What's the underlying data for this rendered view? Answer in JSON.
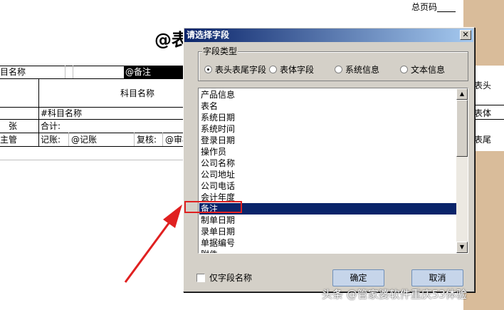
{
  "report": {
    "page_label": "总页码",
    "title": "@表",
    "cells": {
      "item_name": "目名称",
      "remark_field": "@备注",
      "subject_name": "科目名称",
      "subject_name_field": "#科目名称",
      "sheet_unit": "张",
      "total": "合计:",
      "supervisor": "主管",
      "bookkeeping": "记账:",
      "bookkeeping_field": "@记账",
      "review": "复核:",
      "review_field": "@审核"
    },
    "side_tabs": [
      "表头",
      "表体",
      "表尾"
    ]
  },
  "dialog": {
    "title": "请选择字段",
    "close_glyph": "✕",
    "group_label": "字段类型",
    "radio_options": [
      {
        "label": "表头表尾字段",
        "checked": true
      },
      {
        "label": "表体字段",
        "checked": false
      },
      {
        "label": "系统信息",
        "checked": false
      },
      {
        "label": "文本信息",
        "checked": false
      }
    ],
    "list_items": [
      "产品信息",
      "表名",
      "系统日期",
      "系统时间",
      "登录日期",
      "操作员",
      "公司名称",
      "公司地址",
      "公司电话",
      "会计年度",
      "备注",
      "制单日期",
      "录单日期",
      "单据编号",
      "附件"
    ],
    "selected_item": "备注",
    "only_field_name_label": "仅字段名称",
    "only_field_name_checked": false,
    "ok_label": "确定",
    "cancel_label": "取消"
  },
  "watermark": "头条 @管家婆软件重庆53体验",
  "colors": {
    "title_bar": "#0a246a",
    "selection": "#0a246a",
    "annotation": "#e02020",
    "side_panel": "#d9bc9a"
  }
}
